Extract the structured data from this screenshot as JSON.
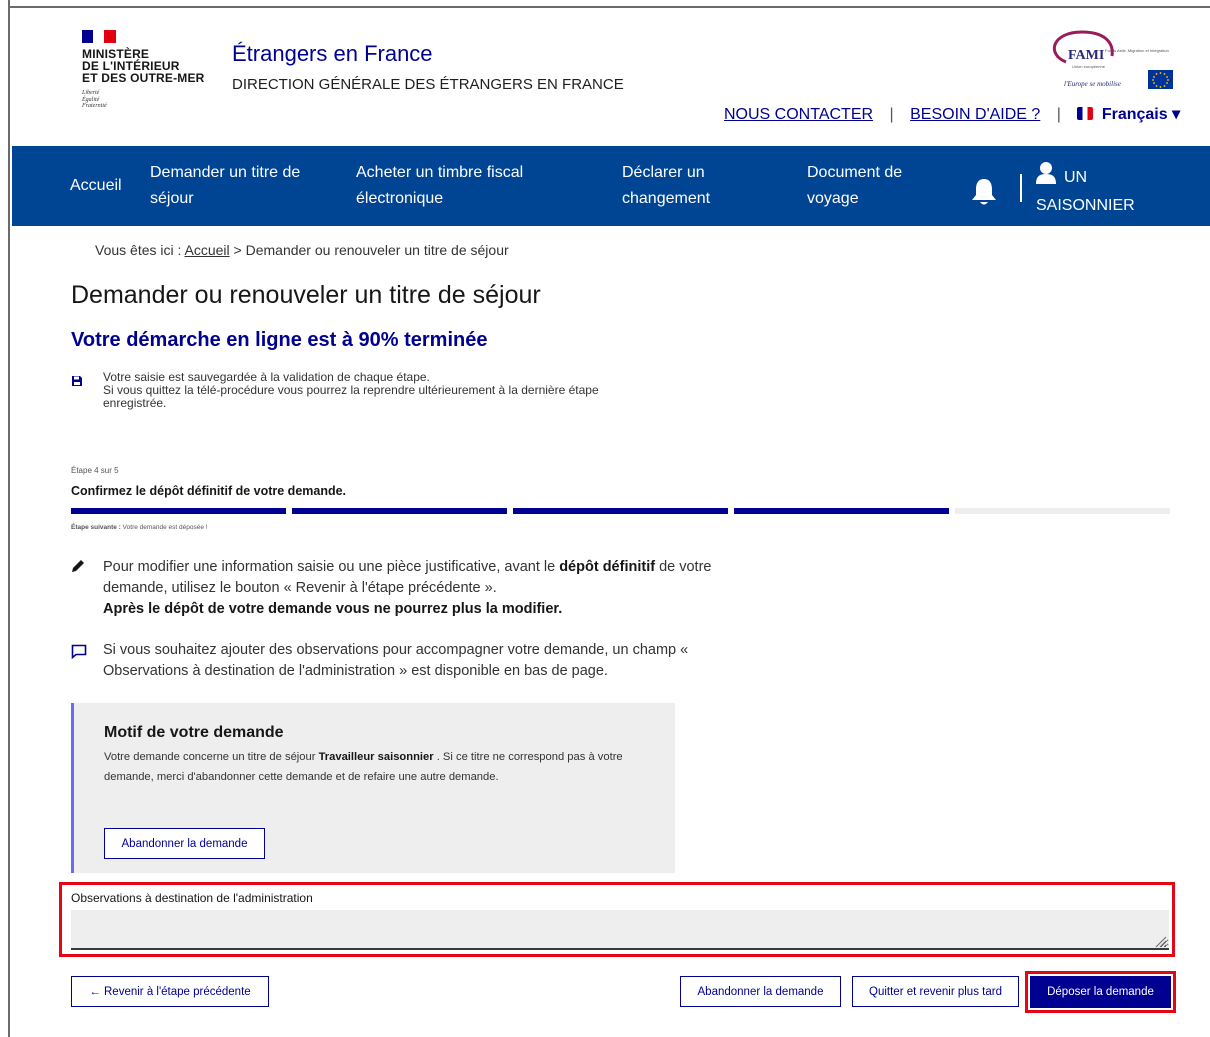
{
  "header": {
    "ministry_lines": [
      "MINISTÈRE",
      "DE L'INTÉRIEUR",
      "ET DES OUTRE-MER"
    ],
    "devise_lines": [
      "Liberté",
      "Égalité",
      "Fraternité"
    ],
    "site_title": "Étrangers en France",
    "site_subtitle": "DIRECTION GÉNÉRALE DES ÉTRANGERS EN FRANCE",
    "fami_logo": {
      "label": "FAMI",
      "tagline": "Fonds Asile, Migration et Intégration",
      "eu": "Union européenne",
      "motto": "l'Europe se mobilise"
    },
    "links": {
      "contact": "NOUS CONTACTER",
      "help": "BESOIN D'AIDE ?",
      "separator": "|",
      "language": "Français ▾"
    }
  },
  "nav": {
    "items": [
      {
        "line1": "Accueil",
        "line2": ""
      },
      {
        "line1": "Demander un titre de",
        "line2": "séjour"
      },
      {
        "line1": "Acheter un timbre fiscal",
        "line2": "électronique"
      },
      {
        "line1": "Déclarer un",
        "line2": "changement"
      },
      {
        "line1": "Document de",
        "line2": "voyage"
      }
    ],
    "user": {
      "line1": "UN",
      "line2": "SAISONNIER"
    }
  },
  "breadcrumb": {
    "prefix": "Vous êtes ici : ",
    "home": "Accueil",
    "rest": " > Demander ou renouveler un titre de séjour"
  },
  "page_title": "Demander ou renouveler un titre de séjour",
  "progress_title": "Votre démarche en ligne est à 90% terminée",
  "progress_percent": 90,
  "save_notice": {
    "line1": "Votre saisie est sauvegardée à la validation de chaque étape.",
    "line2": "Si vous quittez la télé-procédure vous pourrez la reprendre ultérieurement à la dernière étape enregistrée."
  },
  "stepper": {
    "count": "Étape 4 sur 5",
    "current": 4,
    "total": 5,
    "title": "Confirmez le dépôt définitif de votre demande.",
    "next_label": "Étape suivante :",
    "next_value": " Votre demande est déposée !",
    "colors": {
      "done": "#000091",
      "todo": "#eeeeee"
    }
  },
  "info_modify": {
    "part1": "Pour modifier une information saisie ou une pièce justificative, avant le ",
    "bold": "dépôt définitif",
    "part2": " de votre demande, utilisez le bouton « Revenir à l'étape précédente ».",
    "bold_line": "Après le dépôt de votre demande vous ne pourrez plus la modifier."
  },
  "info_observations": "Si vous souhaitez ajouter des observations pour accompagner votre demande, un champ « Observations à destination de l'administration » est disponible en bas de page.",
  "motif": {
    "title": "Motif de votre demande",
    "text_part1": "Votre demande concerne un titre de séjour ",
    "text_bold": "Travailleur saisonnier",
    "text_part2": " . Si ce titre ne correspond pas à votre demande, merci d'abandonner cette demande et de refaire une autre demande.",
    "abandon_button": "Abandonner la demande"
  },
  "observations": {
    "label": "Observations à destination de l'administration",
    "value": ""
  },
  "footer_buttons": {
    "back": "← Revenir à l'étape précédente",
    "abandon": "Abandonner la demande",
    "quit": "Quitter et revenir plus tard",
    "submit": "Déposer la demande"
  },
  "colors": {
    "nav_bg": "#004494",
    "primary": "#000091",
    "highlight": "#e30613",
    "flag_blue": "#000091",
    "flag_red": "#e1000f"
  }
}
